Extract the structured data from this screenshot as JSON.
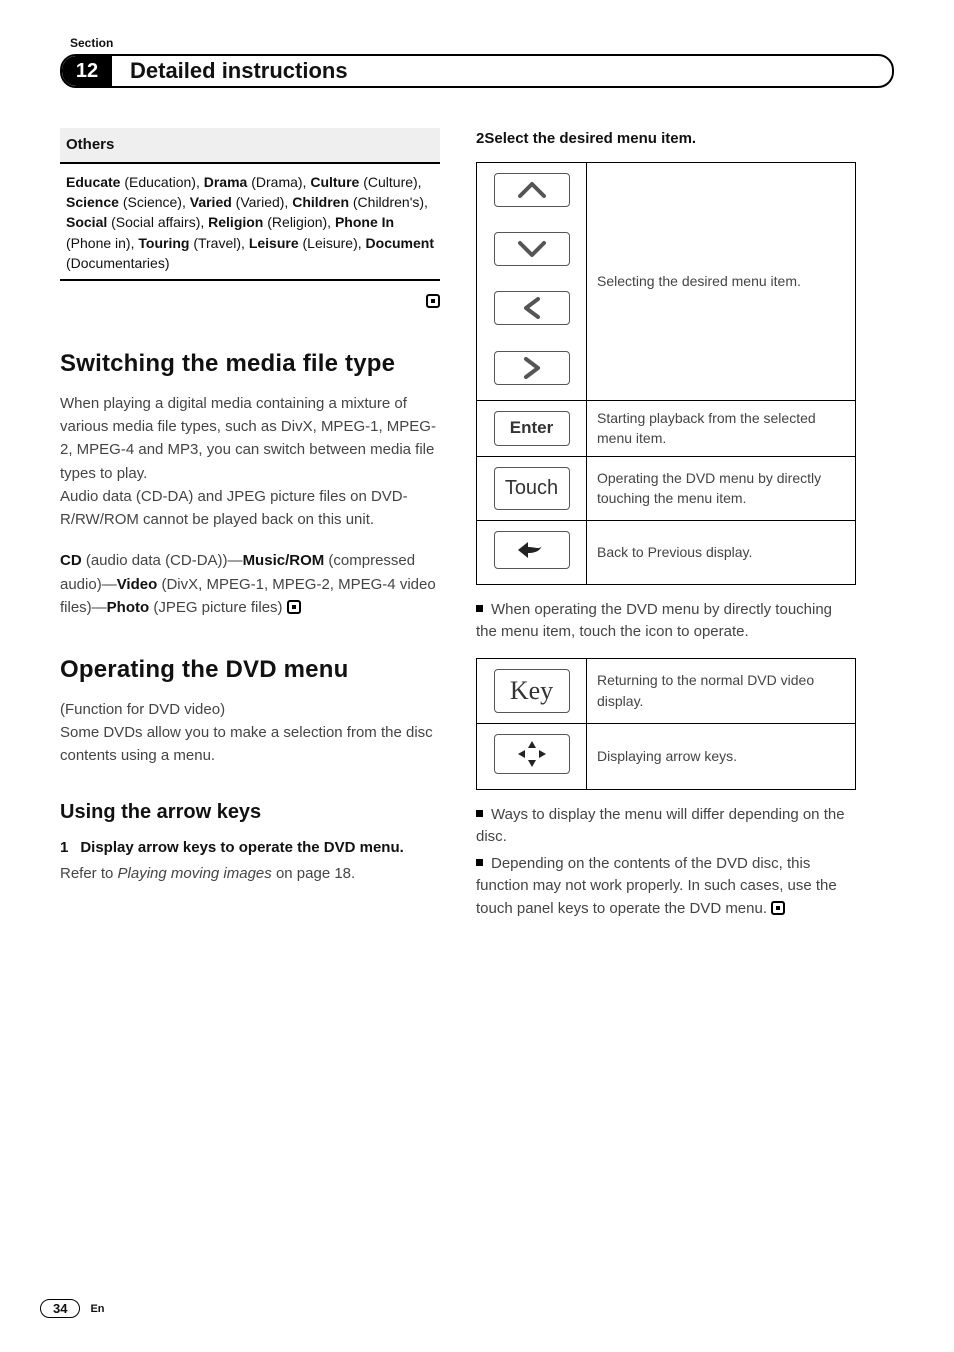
{
  "header": {
    "section_label": "Section",
    "section_number": "12",
    "title": "Detailed instructions"
  },
  "others": {
    "heading": "Others",
    "body_html": "<b>Educate</b> (Education), <b>Drama</b> (Drama), <b>Culture</b> (Culture), <b>Science</b> (Science), <b>Varied</b> (Varied), <b>Children</b> (Children's), <b>Social</b> (Social affairs), <b>Religion</b> (Religion), <b>Phone In</b> (Phone in), <b>Touring</b> (Travel), <b>Leisure</b> (Leisure), <b>Document</b> (Documentaries)"
  },
  "switching": {
    "title": "Switching the media file type",
    "p1": "When playing a digital media containing a mixture of various media file types, such as DivX, MPEG-1, MPEG-2, MPEG-4 and MP3, you can switch between media file types to play.",
    "p2": "Audio data (CD-DA) and JPEG picture files on DVD-R/RW/ROM cannot be played back on this unit.",
    "p3_html": "<b>CD</b> (audio data (CD-DA))—<b>Music/ROM</b> (compressed audio)—<b>Video</b> (DivX, MPEG-1, MPEG-2, MPEG-4 video files)—<b>Photo</b> (JPEG picture files)"
  },
  "dvdmenu": {
    "title": "Operating the DVD menu",
    "sub": "(Function for DVD video)",
    "p1": "Some DVDs allow you to make a selection from the disc contents using a menu.",
    "h2": "Using the arrow keys",
    "step1_html": "<span class='num'>1</span>Display arrow keys to operate the DVD menu.",
    "ref_html": "Refer to <span class='ref'>Playing moving images</span> on page 18."
  },
  "rightcol": {
    "step2_html": "<span class='num'>2</span>Select the desired menu item.",
    "table1": {
      "arrows_desc": "Selecting the desired menu item.",
      "enter_label": "Enter",
      "enter_desc": "Starting playback from the selected menu item.",
      "touch_label": "Touch",
      "touch_desc": "Operating the DVD menu by directly touching the menu item.",
      "back_desc": "Back to Previous display."
    },
    "note1": "When operating the DVD menu by directly touching the menu item, touch the icon to operate.",
    "table2": {
      "key_label": "Key",
      "key_desc": "Returning to the normal DVD video display.",
      "diamond_desc": "Displaying arrow keys."
    },
    "note2": "Ways to display the menu will differ depending on the disc.",
    "note3": "Depending on the contents of the DVD disc, this function may not work properly. In such cases, use the touch panel keys to operate the DVD menu."
  },
  "footer": {
    "page": "34",
    "lang": "En"
  }
}
